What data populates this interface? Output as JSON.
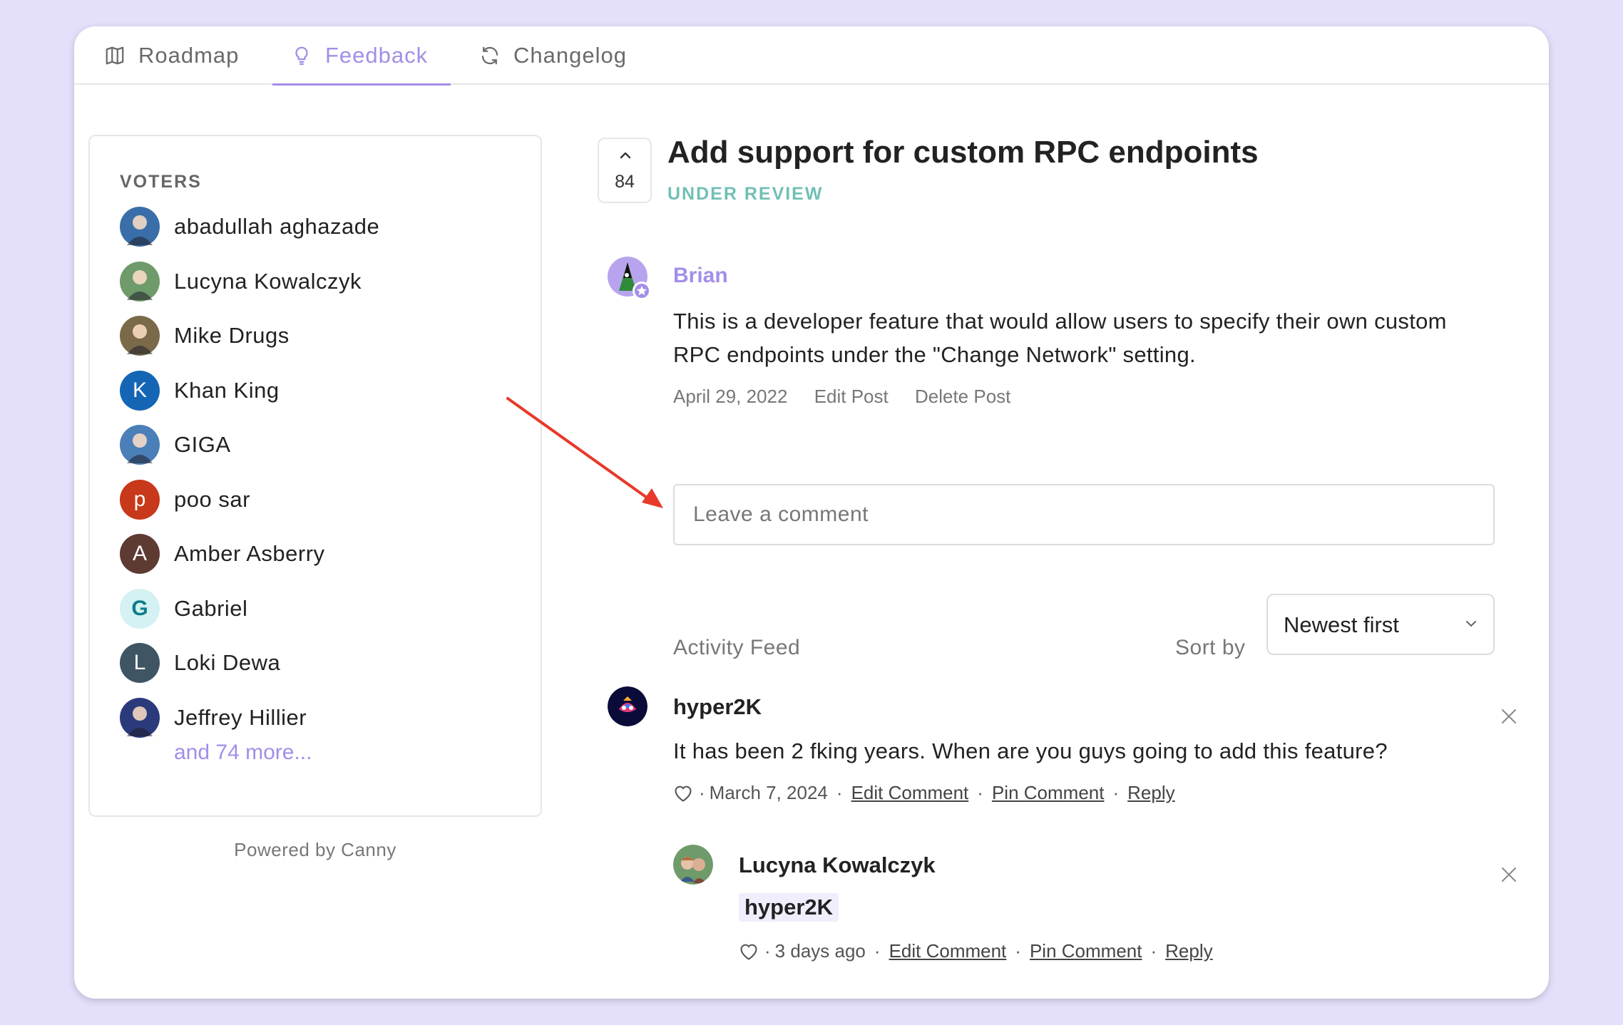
{
  "tabs": [
    {
      "label": "Roadmap",
      "icon": "map-icon"
    },
    {
      "label": "Feedback",
      "icon": "lightbulb-icon"
    },
    {
      "label": "Changelog",
      "icon": "refresh-icon"
    }
  ],
  "active_tab": "Feedback",
  "voters": {
    "title": "VOTERS",
    "items": [
      {
        "name": "abadullah aghazade",
        "initial": "",
        "color": "#3a6ea8"
      },
      {
        "name": "Lucyna Kowalczyk",
        "initial": "",
        "color": "#6f9a6a"
      },
      {
        "name": "Mike Drugs",
        "initial": "",
        "color": "#7a6a4a"
      },
      {
        "name": "Khan King",
        "initial": "K",
        "color": "#1565b5"
      },
      {
        "name": "GIGA",
        "initial": "",
        "color": "#4a7fb8"
      },
      {
        "name": "poo sar",
        "initial": "p",
        "color": "#c8381a"
      },
      {
        "name": "Amber Asberry",
        "initial": "A",
        "color": "#5d3a32"
      },
      {
        "name": "Gabriel",
        "initial": "G",
        "color": "#d4f1f3"
      },
      {
        "name": "Loki Dewa",
        "initial": "L",
        "color": "#3f5564"
      },
      {
        "name": "Jeffrey Hillier",
        "initial": "",
        "color": "#2b3a7a"
      }
    ],
    "more": "and 74 more..."
  },
  "powered_by": "Powered by Canny",
  "post": {
    "vote_count": "84",
    "title": "Add support for custom RPC endpoints",
    "status": "UNDER REVIEW",
    "author": "Brian",
    "body_line1": "This is a developer feature that would allow users to specify their own custom",
    "body_line2": "RPC endpoints under the \"Change Network\" setting.",
    "date": "April 29, 2022",
    "edit_label": "Edit Post",
    "delete_label": "Delete Post"
  },
  "comment_box": {
    "placeholder": "Leave a comment"
  },
  "activity": {
    "label": "Activity Feed",
    "sort_label": "Sort by",
    "sort_value": "Newest first"
  },
  "comments": [
    {
      "author": "hyper2K",
      "text": "It has been 2 fking years. When are you guys going to add this feature?",
      "date": "March 7, 2024",
      "edit": "Edit Comment",
      "pin": "Pin Comment",
      "reply": "Reply"
    },
    {
      "author": "Lucyna Kowalczyk",
      "mention": "hyper2K",
      "date": "3 days ago",
      "edit": "Edit Comment",
      "pin": "Pin Comment",
      "reply": "Reply"
    }
  ],
  "colors": {
    "background": "#e4e0fb",
    "accent": "#a38ee8",
    "status": "#72bfb4",
    "annotation_arrow": "#e8392a"
  }
}
